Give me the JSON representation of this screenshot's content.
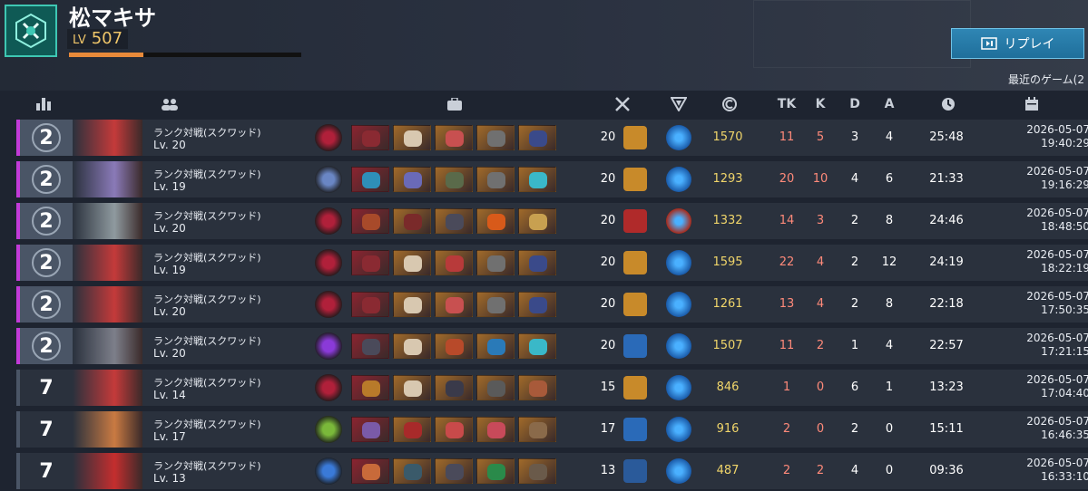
{
  "header": {
    "player_name": "松マキサ",
    "level_label": "LV",
    "level": "507",
    "xp_progress": 0.32,
    "replay_label": "リプレイ",
    "recent_label": "最近のゲーム(2"
  },
  "columns": [
    "rank-icon",
    "players-icon",
    "loadout-icon",
    "weapon-icon",
    "tactic-icon",
    "credits-icon",
    "TK",
    "K",
    "D",
    "A",
    "timer-icon",
    "calendar-icon"
  ],
  "colors": {
    "accent_magenta": "#c23bd8",
    "accent_gray": "#4a5566",
    "credits": "#f0d56a",
    "tk": "#ff8a7a",
    "k": "#ff8a7a"
  },
  "matches": [
    {
      "rank": "2",
      "mode": "ランク対戦(スクワッド)",
      "lv": "Lv. 20",
      "score": "20",
      "credits": "1570",
      "tk": "11",
      "k": "5",
      "d": "3",
      "a": "4",
      "time": "25:48",
      "date": "2026-05-07",
      "clock": "19:40:29"
    },
    {
      "rank": "2",
      "mode": "ランク対戦(スクワッド)",
      "lv": "Lv. 19",
      "score": "20",
      "credits": "1293",
      "tk": "20",
      "k": "10",
      "d": "4",
      "a": "6",
      "time": "21:33",
      "date": "2026-05-07",
      "clock": "19:16:29"
    },
    {
      "rank": "2",
      "mode": "ランク対戦(スクワッド)",
      "lv": "Lv. 20",
      "score": "20",
      "credits": "1332",
      "tk": "14",
      "k": "3",
      "d": "2",
      "a": "8",
      "time": "24:46",
      "date": "2026-05-07",
      "clock": "18:48:50"
    },
    {
      "rank": "2",
      "mode": "ランク対戦(スクワッド)",
      "lv": "Lv. 19",
      "score": "20",
      "credits": "1595",
      "tk": "22",
      "k": "4",
      "d": "2",
      "a": "12",
      "time": "24:19",
      "date": "2026-05-07",
      "clock": "18:22:19"
    },
    {
      "rank": "2",
      "mode": "ランク対戦(スクワッド)",
      "lv": "Lv. 20",
      "score": "20",
      "credits": "1261",
      "tk": "13",
      "k": "4",
      "d": "2",
      "a": "8",
      "time": "22:18",
      "date": "2026-05-07",
      "clock": "17:50:35"
    },
    {
      "rank": "2",
      "mode": "ランク対戦(スクワッド)",
      "lv": "Lv. 20",
      "score": "20",
      "credits": "1507",
      "tk": "11",
      "k": "2",
      "d": "1",
      "a": "4",
      "time": "22:57",
      "date": "2026-05-07",
      "clock": "17:21:15"
    },
    {
      "rank": "7",
      "mode": "ランク対戦(スクワッド)",
      "lv": "Lv. 14",
      "score": "15",
      "credits": "846",
      "tk": "1",
      "k": "0",
      "d": "6",
      "a": "1",
      "time": "13:23",
      "date": "2026-05-07",
      "clock": "17:04:40"
    },
    {
      "rank": "7",
      "mode": "ランク対戦(スクワッド)",
      "lv": "Lv. 17",
      "score": "17",
      "credits": "916",
      "tk": "2",
      "k": "0",
      "d": "2",
      "a": "0",
      "time": "15:11",
      "date": "2026-05-07",
      "clock": "16:46:35"
    },
    {
      "rank": "7",
      "mode": "ランク対戦(スクワッド)",
      "lv": "Lv. 13",
      "score": "13",
      "credits": "487",
      "tk": "2",
      "k": "2",
      "d": "4",
      "a": "0",
      "time": "09:36",
      "date": "2026-05-07",
      "clock": "16:33:10"
    }
  ]
}
